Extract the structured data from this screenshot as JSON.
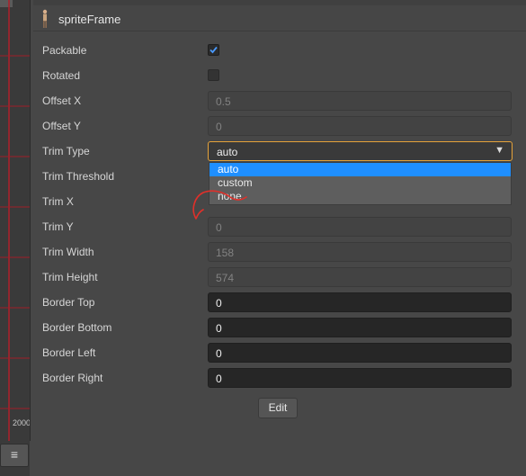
{
  "header": {
    "title": "spriteFrame",
    "icon": "character-sprite-icon"
  },
  "left_panel": {
    "axis_label": "2000",
    "menu_icon": "≡"
  },
  "rows": {
    "packable": {
      "label": "Packable",
      "checked": true
    },
    "rotated": {
      "label": "Rotated",
      "checked": false
    },
    "offset_x": {
      "label": "Offset X",
      "value": "0.5"
    },
    "offset_y": {
      "label": "Offset Y",
      "value": "0"
    },
    "trim_type": {
      "label": "Trim Type",
      "value": "auto",
      "options": [
        "auto",
        "custom",
        "none"
      ],
      "selected_index": 0
    },
    "trim_threshold": {
      "label": "Trim Threshold"
    },
    "trim_x": {
      "label": "Trim X"
    },
    "trim_y": {
      "label": "Trim Y",
      "value": "0"
    },
    "trim_width": {
      "label": "Trim Width",
      "value": "158"
    },
    "trim_height": {
      "label": "Trim Height",
      "value": "574"
    },
    "border_top": {
      "label": "Border Top",
      "value": "0"
    },
    "border_bottom": {
      "label": "Border Bottom",
      "value": "0"
    },
    "border_left": {
      "label": "Border Left",
      "value": "0"
    },
    "border_right": {
      "label": "Border Right",
      "value": "0"
    }
  },
  "edit_button": {
    "label": "Edit"
  },
  "colors": {
    "accent_focus": "#e6a33a",
    "selection": "#1f8fff",
    "grid_line": "#b0202a",
    "annotation": "#e0302a"
  }
}
